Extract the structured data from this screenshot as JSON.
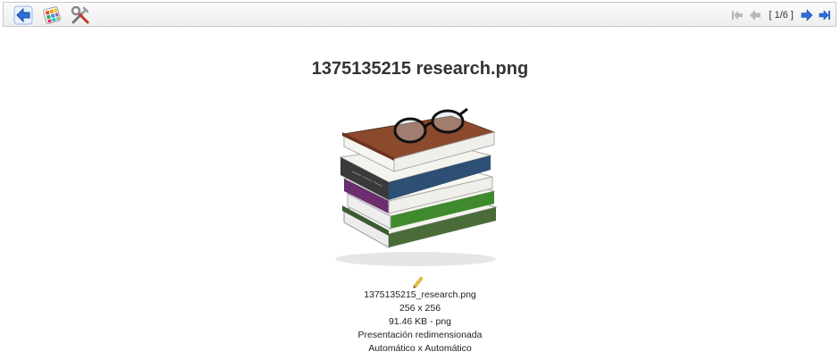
{
  "toolbar": {
    "left_icons": [
      "back-arrow-icon",
      "color-palette-icon",
      "tools-icon"
    ],
    "nav_icons": [
      "first-page-icon",
      "previous-page-icon",
      "next-page-icon",
      "last-page-icon"
    ],
    "page_indicator": "[ 1/6 ]"
  },
  "title": "1375135215 research.png",
  "image": {
    "icon": "books-with-glasses-image"
  },
  "details": {
    "filename": "1375135215_research.png",
    "dimensions": "256 x 256",
    "size": "91.46 KB - png",
    "presentation": "Presentación redimensionada",
    "scale": "Automático x Automático"
  },
  "colors": {
    "arrow_blue": "#2b6fd6",
    "toolbar_border": "#c9c9c9",
    "disabled_gray": "#b8b8b8"
  }
}
